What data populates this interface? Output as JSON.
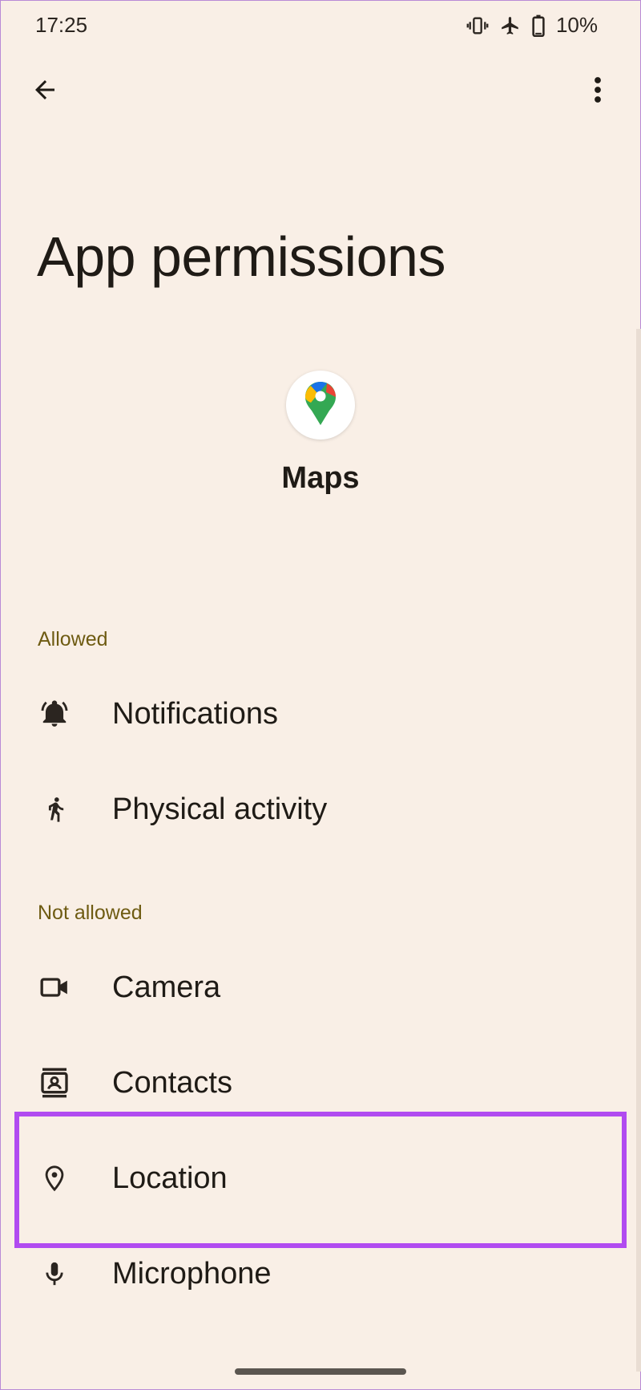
{
  "status_bar": {
    "time": "17:25",
    "battery": "10%",
    "icons": [
      "vibrate-icon",
      "airplane-icon",
      "battery-icon"
    ]
  },
  "app_bar": {
    "back_icon": "arrow-left-icon",
    "more_icon": "more-vert-icon"
  },
  "page": {
    "title": "App permissions"
  },
  "app": {
    "name": "Maps",
    "icon": "google-maps-pin-icon"
  },
  "sections": {
    "allowed": {
      "label": "Allowed",
      "items": [
        {
          "label": "Notifications",
          "icon": "bell-icon"
        },
        {
          "label": "Physical activity",
          "icon": "walking-icon"
        }
      ]
    },
    "not_allowed": {
      "label": "Not allowed",
      "items": [
        {
          "label": "Camera",
          "icon": "camera-icon"
        },
        {
          "label": "Contacts",
          "icon": "contacts-icon"
        },
        {
          "label": "Location",
          "icon": "location-pin-icon"
        },
        {
          "label": "Microphone",
          "icon": "microphone-icon"
        }
      ]
    }
  },
  "colors": {
    "background": "#f9efe6",
    "section_label": "#6e5b12",
    "highlight_border": "#b14bf0"
  }
}
